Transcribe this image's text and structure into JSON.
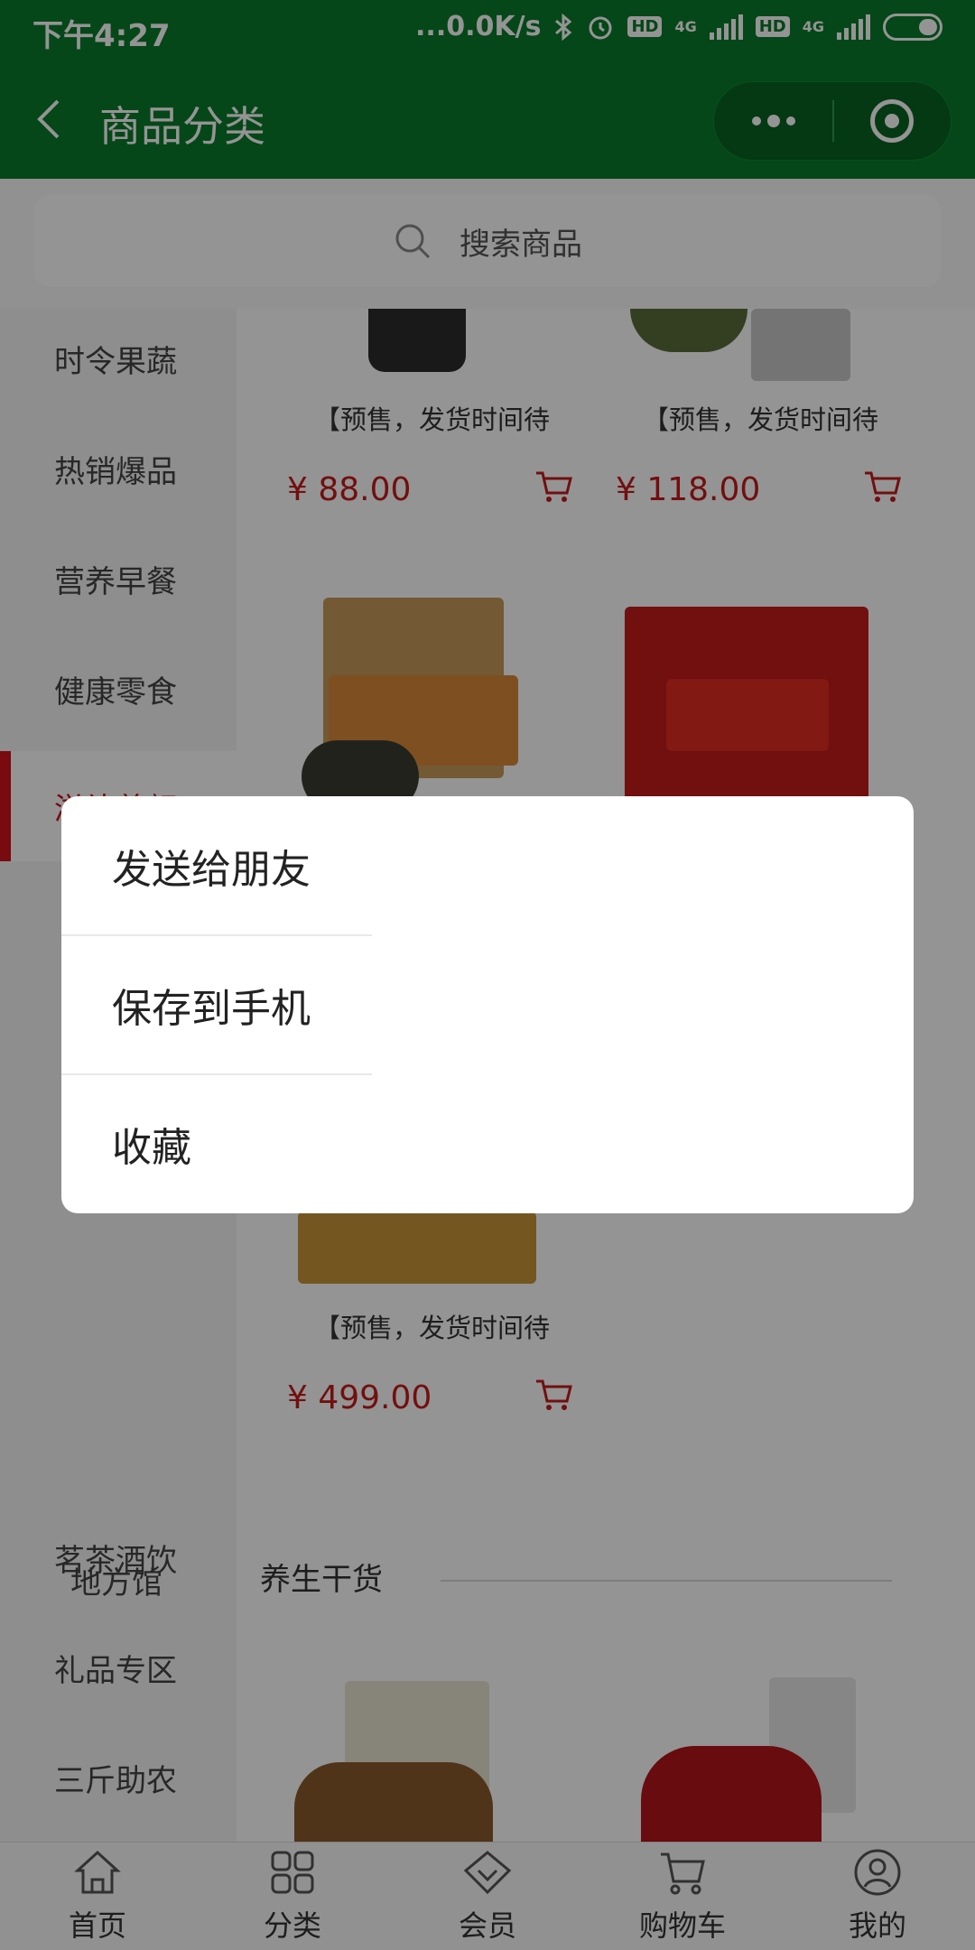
{
  "status": {
    "time": "下午4:27",
    "speed": "...0.0K/s",
    "hd1": "HD",
    "net1": "4G",
    "hd2": "HD",
    "net2": "4G"
  },
  "header": {
    "title": "商品分类"
  },
  "search": {
    "placeholder": "搜索商品"
  },
  "sidebar": {
    "items": [
      {
        "label": "时令果蔬"
      },
      {
        "label": "热销爆品"
      },
      {
        "label": "营养早餐"
      },
      {
        "label": "健康零食"
      },
      {
        "label": "滋补养颜"
      },
      {
        "label": "茗茶酒饮"
      },
      {
        "label": "礼品专区"
      },
      {
        "label": "三斤助农"
      },
      {
        "label": "地方馆"
      }
    ],
    "active_index": 4
  },
  "products": [
    {
      "name": "【预售，发货时间待",
      "price": "¥ 88.00"
    },
    {
      "name": "【预售，发货时间待",
      "price": "¥ 118.00"
    },
    {
      "name": "【预售，发货时间待",
      "price": "¥ 499.00"
    }
  ],
  "section": {
    "title": "养生干货"
  },
  "tabbar": {
    "items": [
      {
        "label": "首页",
        "icon": "home-icon"
      },
      {
        "label": "分类",
        "icon": "grid-icon"
      },
      {
        "label": "会员",
        "icon": "diamond-icon"
      },
      {
        "label": "购物车",
        "icon": "cart-icon"
      },
      {
        "label": "我的",
        "icon": "user-icon"
      }
    ]
  },
  "dialog": {
    "items": [
      {
        "label": "发送给朋友"
      },
      {
        "label": "保存到手机"
      },
      {
        "label": "收藏"
      }
    ]
  },
  "colors": {
    "brand_green": "#0a7a2a",
    "accent_red": "#d0121b",
    "price_red": "#c41b1b"
  }
}
